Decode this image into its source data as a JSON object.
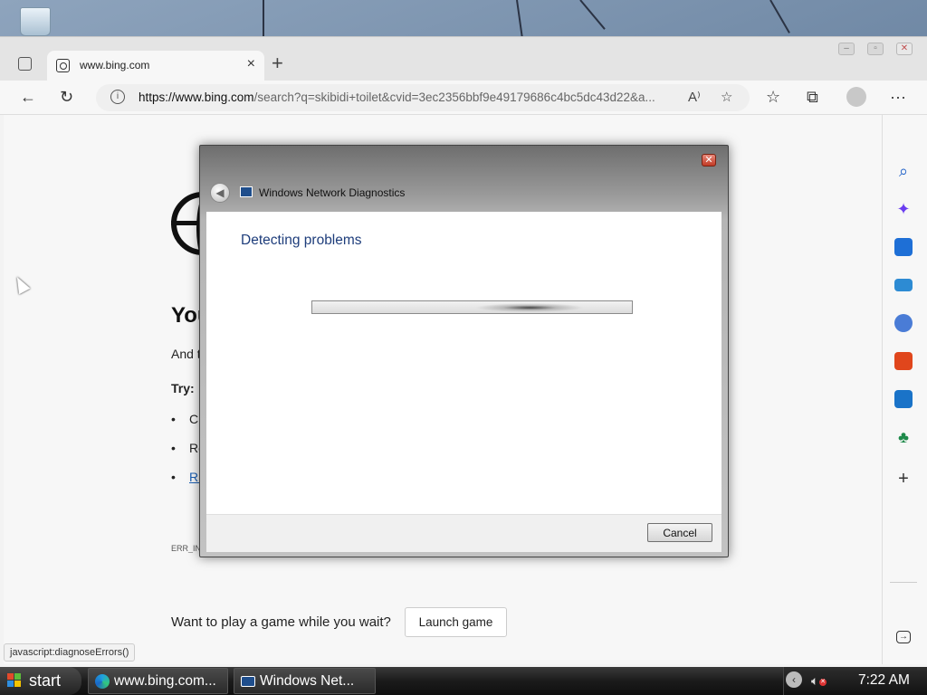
{
  "browser": {
    "tab_title": "www.bing.com",
    "tab_close": "×",
    "new_tab": "+",
    "url_host": "https://www.bing.com",
    "url_rest": "/search?q=skibidi+toilet&cvid=3ec2356bbf9e49179686c4bc5dc43d22&a...",
    "info_glyph": "i",
    "read_aloud_glyph": "A⁾",
    "favorite_glyph": "☆",
    "favorites_glyph": "☆",
    "collections_glyph": "⧉",
    "more_glyph": "···",
    "back_glyph": "←",
    "refresh_glyph": "↻"
  },
  "page": {
    "heading": "You",
    "line1": "And t",
    "try_label": "Try:",
    "bullets": [
      "Ch",
      "Re",
      "Ru"
    ],
    "error_code": "ERR_IN",
    "game_question": "Want to play a game while you wait?",
    "launch_button": "Launch game",
    "status_url": "javascript:diagnoseErrors()"
  },
  "sidebar": {
    "plus_glyph": "+"
  },
  "dialog": {
    "title": "Windows Network Diagnostics",
    "heading": "Detecting problems",
    "cancel": "Cancel",
    "close_glyph": "✕",
    "back_glyph": "◀"
  },
  "taskbar": {
    "start_label": "start",
    "tasks": [
      {
        "label": "www.bing.com..."
      },
      {
        "label": "Windows Net..."
      }
    ],
    "tray_arrow": "‹",
    "clock": "7:22 AM"
  },
  "colors": {
    "dialog_heading": "#1e3d7b",
    "link": "#1a5fb4",
    "edge_blue": "#0a5fb4"
  }
}
